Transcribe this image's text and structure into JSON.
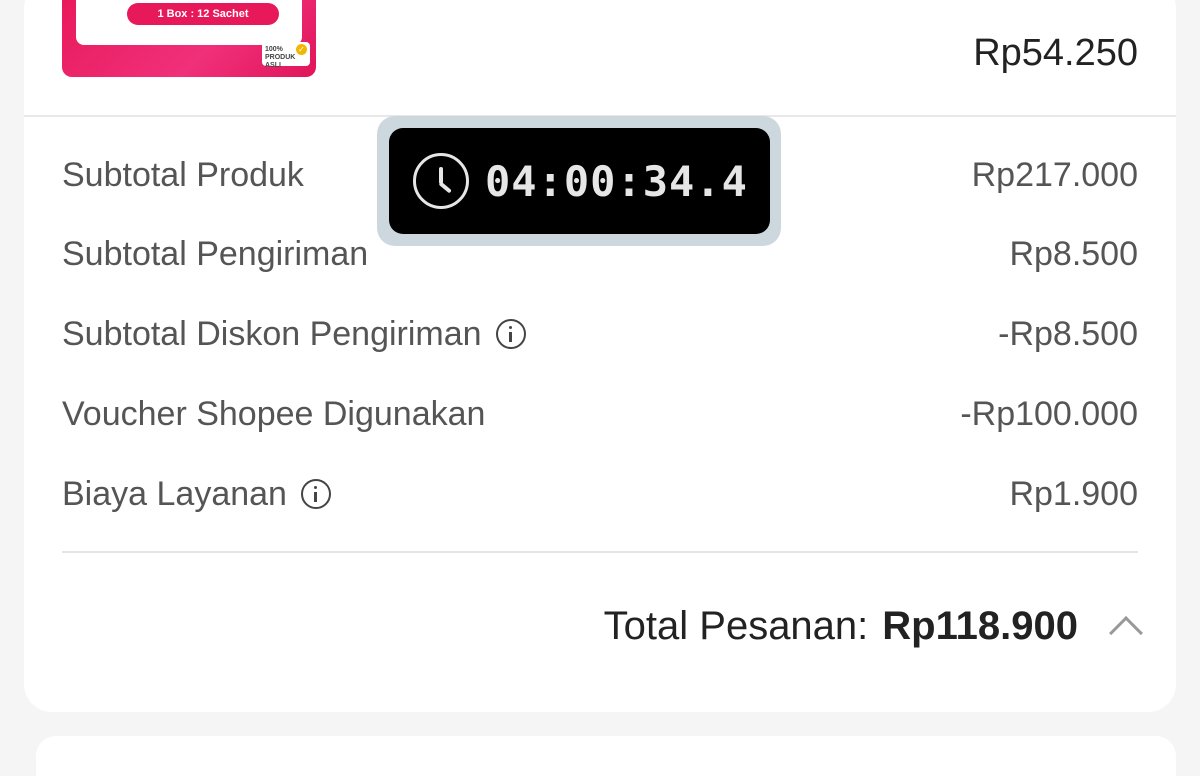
{
  "product": {
    "package_label": "1 Box : 12 Sachet",
    "badge_text": "100% PRODUK ASLI",
    "price": "Rp54.250"
  },
  "summary": {
    "rows": [
      {
        "label": "Subtotal Produk",
        "value": "Rp217.000",
        "has_info": false
      },
      {
        "label": "Subtotal Pengiriman",
        "value": "Rp8.500",
        "has_info": false
      },
      {
        "label": "Subtotal Diskon Pengiriman",
        "value": "-Rp8.500",
        "has_info": true
      },
      {
        "label": "Voucher Shopee Digunakan",
        "value": "-Rp100.000",
        "has_info": false
      },
      {
        "label": "Biaya Layanan",
        "value": "Rp1.900",
        "has_info": true
      }
    ],
    "total_label": "Total Pesanan:",
    "total_value": "Rp118.900"
  },
  "timer": {
    "value": "04:00:34.4"
  },
  "colors": {
    "brand_pink": "#e8195a",
    "text_primary": "#222222",
    "text_secondary": "#555555"
  }
}
